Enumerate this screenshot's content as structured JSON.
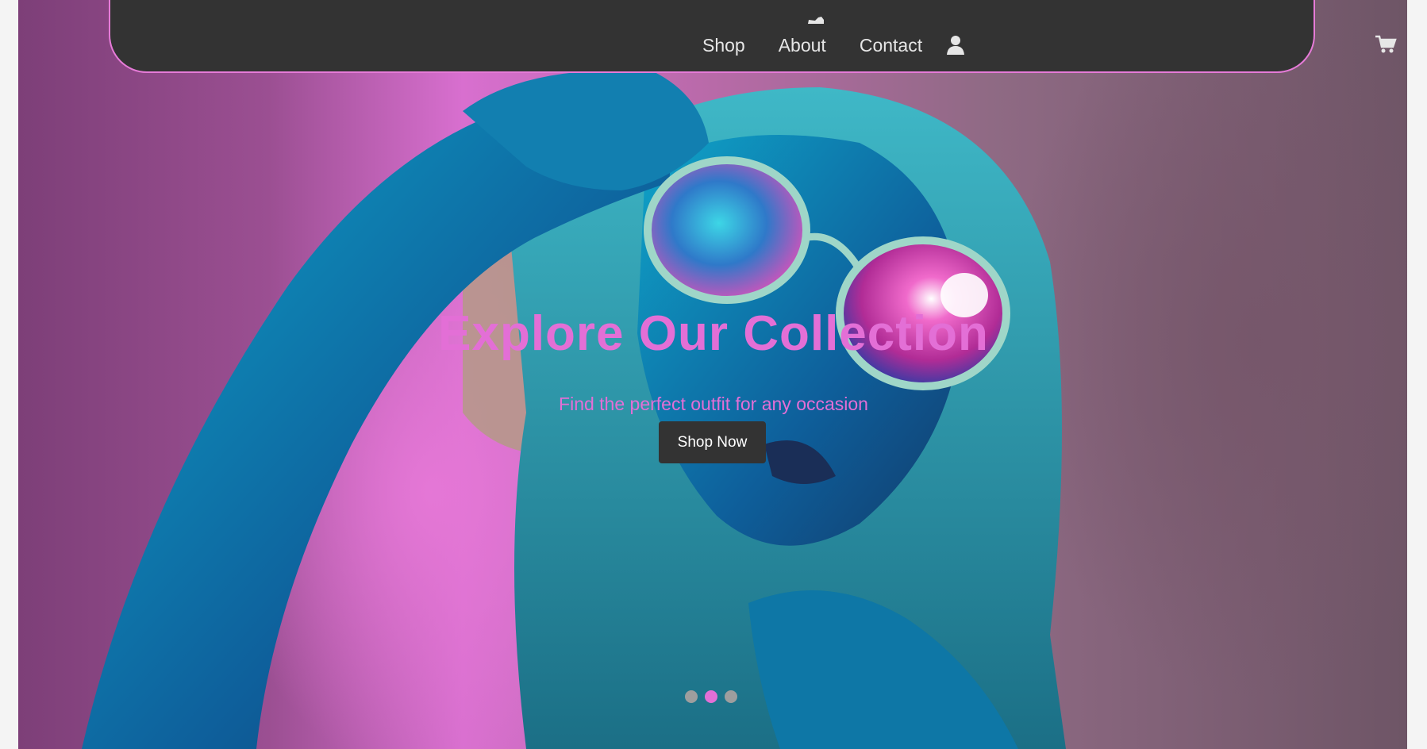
{
  "nav": {
    "links": [
      "Shop",
      "About",
      "Contact"
    ],
    "user_icon": "user-icon",
    "cart_icon": "cart-icon",
    "logo_icon": "shoe-logo-icon"
  },
  "hero": {
    "title": "Explore Our Collection",
    "subtitle": "Find the perfect outfit for any occasion",
    "cta_label": "Shop Now",
    "image": "woman-with-neon-sunglasses-photo"
  },
  "carousel": {
    "slides": 3,
    "active_index": 1
  },
  "colors": {
    "accent": "#e36fd6",
    "navbar_bg": "#333333",
    "button_bg": "#333333"
  }
}
